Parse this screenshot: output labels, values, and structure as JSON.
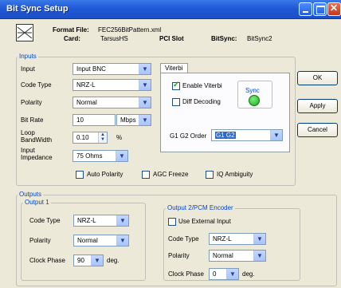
{
  "window": {
    "title": "Bit Sync Setup"
  },
  "header": {
    "format_file_label": "Format File:",
    "format_file_value": "FEC256BitPattern.xml",
    "card_label": "Card:",
    "card_value": "TarsusHS",
    "pci_label": "PCI Slot",
    "bitsync_label": "BitSync:",
    "bitsync_value": "BitSync2"
  },
  "inputs": {
    "group_label": "Inputs",
    "input_label": "Input",
    "input_value": "Input BNC",
    "code_type_label": "Code Type",
    "code_type_value": "NRZ-L",
    "polarity_label": "Polarity",
    "polarity_value": "Normal",
    "bit_rate_label": "Bit Rate",
    "bit_rate_value": "10",
    "bit_rate_unit": "Mbps",
    "loop_bw_label_1": "Loop",
    "loop_bw_label_2": "BandWidth",
    "loop_bw_value": "0.10",
    "loop_bw_unit": "%",
    "impedance_label_1": "Input",
    "impedance_label_2": "Impedance",
    "impedance_value": "75 Ohms",
    "auto_polarity": "Auto Polarity",
    "agc_freeze": "AGC Freeze",
    "iq_ambiguity": "IQ Ambiguity"
  },
  "viterbi": {
    "tab_label": "Viterbi",
    "enable_label": "Enable Viterbi",
    "enable_checked": true,
    "diff_decoding_label": "Diff Decoding",
    "sync_label": "Sync",
    "g1g2_label": "G1 G2 Order",
    "g1g2_value": "G1 G2"
  },
  "buttons": {
    "ok": "OK",
    "apply": "Apply",
    "cancel": "Cancel"
  },
  "outputs": {
    "group_label": "Outputs",
    "output1": {
      "group_label": "Output 1",
      "code_type_label": "Code Type",
      "code_type_value": "NRZ-L",
      "polarity_label": "Polarity",
      "polarity_value": "Normal",
      "clock_phase_label": "Clock Phase",
      "clock_phase_value": "90",
      "clock_phase_unit": "deg."
    },
    "output2": {
      "group_label": "Output 2/PCM Encoder",
      "use_external_label": "Use External Input",
      "code_type_label": "Code Type",
      "code_type_value": "NRZ-L",
      "polarity_label": "Polarity",
      "polarity_value": "Normal",
      "clock_phase_label": "Clock Phase",
      "clock_phase_value": "0",
      "clock_phase_unit": "deg."
    }
  },
  "icons": {
    "header_icon": "bitsync-icon",
    "minimize": "minimize-icon",
    "maximize": "maximize-icon",
    "close": "close-icon",
    "dropdown": "chevron-down-icon"
  }
}
